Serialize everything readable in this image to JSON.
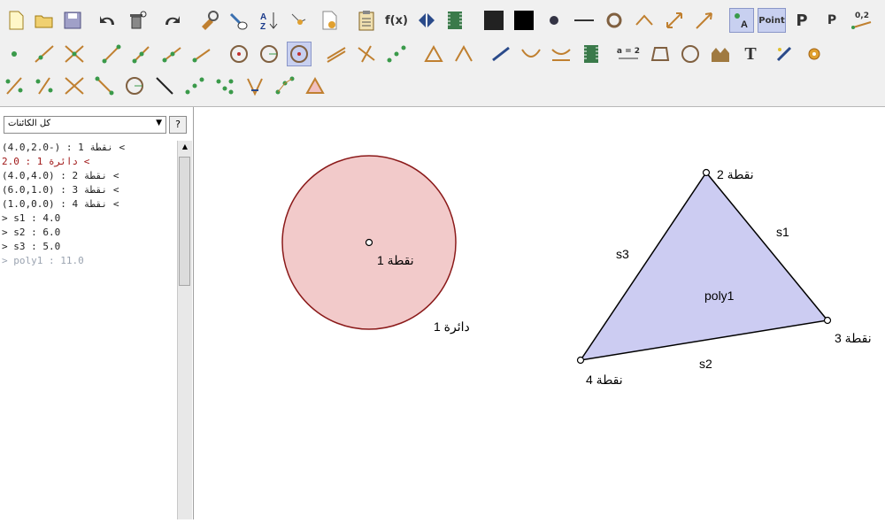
{
  "toolbar": {
    "fx_label": "f(x)",
    "point_label": "Point",
    "p_label": "P",
    "p_small_label": "P",
    "decimal_label": "0,2",
    "slider_label": "a = 2",
    "text_label": "T"
  },
  "sidebar": {
    "filter_value": "كل الكائنات",
    "help_label": "?",
    "items": [
      {
        "text": "(4.0,2.0-) : نقطة 1 <",
        "style": "normal"
      },
      {
        "text": "2.0 : دائرة 1 <",
        "style": "red"
      },
      {
        "text": "(4.0,4.0) : نقطة 2 <",
        "style": "normal"
      },
      {
        "text": "(6.0,1.0) : نقطة 3 <",
        "style": "normal"
      },
      {
        "text": "(1.0,0.0) : نقطة 4 <",
        "style": "normal"
      },
      {
        "text": "> s1 : 4.0",
        "style": "normal"
      },
      {
        "text": "> s2 : 6.0",
        "style": "normal"
      },
      {
        "text": "> s3 : 5.0",
        "style": "normal"
      },
      {
        "text": "> poly1 : 11.0",
        "style": "gray"
      }
    ]
  },
  "canvas": {
    "point1_label": "نقطة 1",
    "circle1_label": "دائرة 1",
    "point2_label": "نقطة 2",
    "point3_label": "نقطة 3",
    "point4_label": "نقطة 4",
    "s1_label": "s1",
    "s2_label": "s2",
    "s3_label": "s3",
    "poly_label": "poly1",
    "circle_fill": "#f2caca",
    "circle_stroke": "#8b1a1a",
    "poly_fill": "#ccccf2",
    "circle_label_color": "#8b1a1a"
  }
}
